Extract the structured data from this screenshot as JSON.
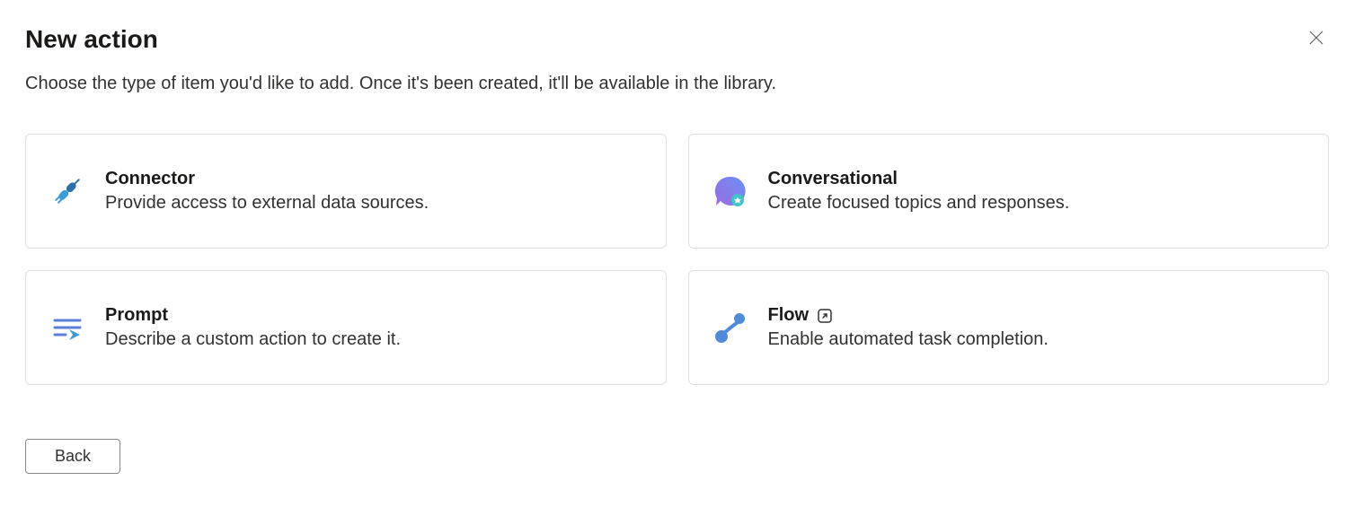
{
  "header": {
    "title": "New action",
    "subtitle": "Choose the type of item you'd like to add. Once it's been created, it'll be available in the library."
  },
  "cards": {
    "connector": {
      "title": "Connector",
      "description": "Provide access to external data sources."
    },
    "conversational": {
      "title": "Conversational",
      "description": "Create focused topics and responses."
    },
    "prompt": {
      "title": "Prompt",
      "description": "Describe a custom action to create it."
    },
    "flow": {
      "title": "Flow",
      "description": "Enable automated task completion."
    }
  },
  "footer": {
    "back_label": "Back"
  }
}
